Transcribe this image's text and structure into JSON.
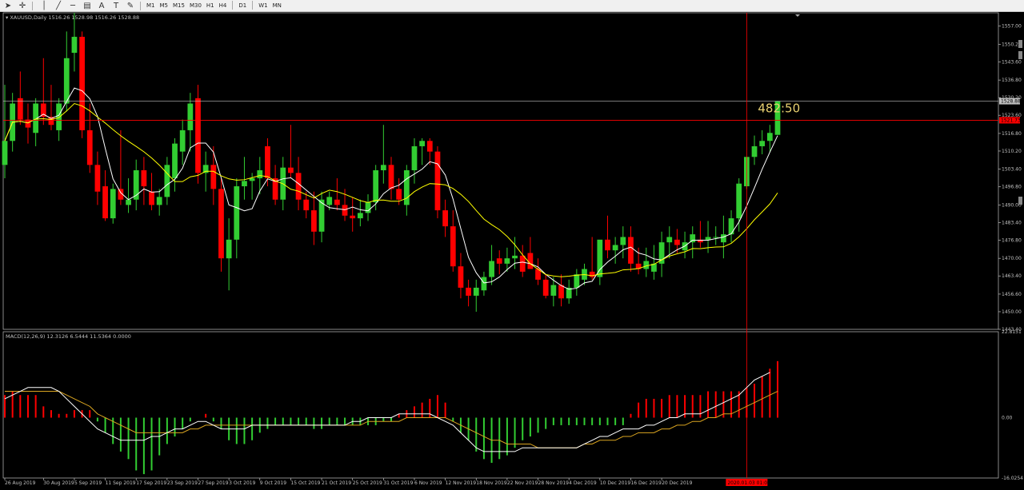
{
  "toolbar": {
    "tools": [
      "cursor-arrow-icon",
      "crosshair-icon",
      "vertical-line-icon",
      "trend-line-icon",
      "horizontal-line-icon",
      "channel-icon",
      "text-tool-icon",
      "label-tool-icon",
      "shapes-dropdown-icon"
    ],
    "timeframes": [
      "M1",
      "M5",
      "M15",
      "M30",
      "H1",
      "H4",
      "D1",
      "W1",
      "MN"
    ]
  },
  "colors": {
    "background": "#000000",
    "bull": "#32cd32",
    "bear": "#ff0000",
    "ma_fast": "#ffffff",
    "ma_slow": "#ffff00",
    "crosshair": "#ff0000",
    "grid_border": "#c0c0c0",
    "axis_text": "#c0c0c0",
    "bid_line": "#c0c0c0",
    "price_label": "#e8d070"
  },
  "chart_data": [
    {
      "type": "candlestick",
      "title": "XAUUSD,Daily",
      "ohlc_header": "1516.26 1528.98 1516.26 1528.88",
      "ylim": [
        1443.4,
        1562.0
      ],
      "y_ticks": [
        "1557.00",
        "1550.20",
        "1543.60",
        "1536.80",
        "1530.20",
        "1523.60",
        "1516.80",
        "1510.20",
        "1503.40",
        "1496.80",
        "1490.00",
        "1483.40",
        "1476.80",
        "1470.00",
        "1463.40",
        "1456.60",
        "1450.00",
        "1443.40"
      ],
      "x_ticks": [
        "26 Aug 2019",
        "30 Aug 2019",
        "5 Sep 2019",
        "11 Sep 2019",
        "17 Sep 2019",
        "23 Sep 2019",
        "27 Sep 2019",
        "3 Oct 2019",
        "9 Oct 2019",
        "15 Oct 2019",
        "21 Oct 2019",
        "25 Oct 2019",
        "31 Oct 2019",
        "6 Nov 2019",
        "12 Nov 2019",
        "18 Nov 2019",
        "22 Nov 2019",
        "28 Nov 2019",
        "4 Dec 2019",
        "10 Dec 2019",
        "16 Dec 2019",
        "20 Dec 2019"
      ],
      "current_price": "1528.88",
      "crosshair_price": "1521.73",
      "crosshair_readout": "482:50",
      "crosshair_date": "2020.01.03 01:00",
      "crosshair_index": 96,
      "moving_averages": [
        {
          "period": 5,
          "color": "#ffffff"
        },
        {
          "period": 13,
          "color": "#ffff00"
        }
      ],
      "candles": [
        [
          1505,
          1535,
          1500,
          1514
        ],
        [
          1514,
          1532,
          1510,
          1528
        ],
        [
          1530,
          1540,
          1520,
          1522
        ],
        [
          1522,
          1528,
          1513,
          1519
        ],
        [
          1517,
          1530,
          1512,
          1528
        ],
        [
          1528,
          1545,
          1520,
          1523
        ],
        [
          1523,
          1535,
          1518,
          1520
        ],
        [
          1518,
          1530,
          1514,
          1528
        ],
        [
          1528,
          1555,
          1525,
          1545
        ],
        [
          1547,
          1562,
          1540,
          1553
        ],
        [
          1553,
          1555,
          1515,
          1518
        ],
        [
          1518,
          1528,
          1502,
          1505
        ],
        [
          1505,
          1510,
          1490,
          1495
        ],
        [
          1497,
          1503,
          1484,
          1485
        ],
        [
          1485,
          1498,
          1483,
          1496
        ],
        [
          1496,
          1518,
          1490,
          1492
        ],
        [
          1490,
          1500,
          1487,
          1492
        ],
        [
          1492,
          1507,
          1488,
          1503
        ],
        [
          1503,
          1508,
          1490,
          1497
        ],
        [
          1495,
          1502,
          1488,
          1490
        ],
        [
          1490,
          1496,
          1486,
          1493
        ],
        [
          1493,
          1508,
          1490,
          1505
        ],
        [
          1500,
          1515,
          1495,
          1513
        ],
        [
          1510,
          1522,
          1505,
          1518
        ],
        [
          1518,
          1532,
          1510,
          1528
        ],
        [
          1530,
          1535,
          1498,
          1502
        ],
        [
          1502,
          1510,
          1495,
          1505
        ],
        [
          1505,
          1512,
          1490,
          1496
        ],
        [
          1496,
          1500,
          1465,
          1470
        ],
        [
          1470,
          1485,
          1458,
          1477
        ],
        [
          1477,
          1500,
          1470,
          1497
        ],
        [
          1497,
          1508,
          1492,
          1499
        ],
        [
          1499,
          1502,
          1492,
          1500
        ],
        [
          1500,
          1508,
          1494,
          1503
        ],
        [
          1512,
          1515,
          1497,
          1500
        ],
        [
          1500,
          1505,
          1490,
          1492
        ],
        [
          1492,
          1508,
          1488,
          1504
        ],
        [
          1504,
          1520,
          1500,
          1502
        ],
        [
          1502,
          1508,
          1488,
          1492
        ],
        [
          1492,
          1495,
          1485,
          1488
        ],
        [
          1488,
          1495,
          1475,
          1480
        ],
        [
          1480,
          1495,
          1476,
          1492
        ],
        [
          1490,
          1495,
          1488,
          1493
        ],
        [
          1492,
          1500,
          1488,
          1490
        ],
        [
          1490,
          1496,
          1484,
          1486
        ],
        [
          1486,
          1493,
          1480,
          1485
        ],
        [
          1485,
          1492,
          1482,
          1487
        ],
        [
          1487,
          1494,
          1484,
          1491
        ],
        [
          1491,
          1505,
          1488,
          1503
        ],
        [
          1503,
          1520,
          1498,
          1505
        ],
        [
          1505,
          1508,
          1492,
          1496
        ],
        [
          1496,
          1500,
          1490,
          1492
        ],
        [
          1490,
          1505,
          1486,
          1503
        ],
        [
          1503,
          1515,
          1498,
          1512
        ],
        [
          1512,
          1515,
          1505,
          1514
        ],
        [
          1514,
          1515,
          1505,
          1510
        ],
        [
          1510,
          1512,
          1485,
          1488
        ],
        [
          1488,
          1492,
          1478,
          1482
        ],
        [
          1482,
          1488,
          1465,
          1467
        ],
        [
          1467,
          1472,
          1455,
          1459
        ],
        [
          1459,
          1462,
          1452,
          1456
        ],
        [
          1456,
          1462,
          1450,
          1459
        ],
        [
          1458,
          1465,
          1456,
          1463
        ],
        [
          1463,
          1475,
          1460,
          1469
        ],
        [
          1470,
          1473,
          1464,
          1468
        ],
        [
          1468,
          1474,
          1465,
          1470
        ],
        [
          1470,
          1478,
          1466,
          1471
        ],
        [
          1471,
          1475,
          1463,
          1465
        ],
        [
          1472,
          1478,
          1468,
          1466
        ],
        [
          1466,
          1470,
          1460,
          1462
        ],
        [
          1462,
          1464,
          1455,
          1456
        ],
        [
          1456,
          1463,
          1452,
          1460
        ],
        [
          1460,
          1464,
          1452,
          1455
        ],
        [
          1455,
          1462,
          1453,
          1459
        ],
        [
          1459,
          1466,
          1456,
          1464
        ],
        [
          1462,
          1468,
          1460,
          1466
        ],
        [
          1465,
          1478,
          1462,
          1463
        ],
        [
          1463,
          1476,
          1460,
          1477
        ],
        [
          1477,
          1486,
          1470,
          1473
        ],
        [
          1473,
          1478,
          1468,
          1475
        ],
        [
          1475,
          1482,
          1470,
          1478
        ],
        [
          1478,
          1482,
          1465,
          1468
        ],
        [
          1468,
          1474,
          1464,
          1466
        ],
        [
          1466,
          1474,
          1463,
          1469
        ],
        [
          1465,
          1475,
          1462,
          1468
        ],
        [
          1468,
          1480,
          1463,
          1476
        ],
        [
          1476,
          1482,
          1470,
          1478
        ],
        [
          1477,
          1481,
          1472,
          1475
        ],
        [
          1473,
          1480,
          1470,
          1476
        ],
        [
          1476,
          1482,
          1470,
          1479
        ],
        [
          1477,
          1484,
          1474,
          1476
        ],
        [
          1477,
          1484,
          1472,
          1478
        ],
        [
          1478,
          1482,
          1475,
          1478
        ],
        [
          1476,
          1486,
          1470,
          1479
        ],
        [
          1479,
          1488,
          1476,
          1485
        ],
        [
          1485,
          1500,
          1480,
          1498
        ],
        [
          1497,
          1508,
          1496,
          1508
        ],
        [
          1508,
          1516,
          1505,
          1512
        ],
        [
          1512,
          1518,
          1509,
          1514
        ],
        [
          1514,
          1520,
          1510,
          1517
        ],
        [
          1516.26,
          1528.98,
          1516.26,
          1528.88
        ]
      ]
    },
    {
      "type": "histogram",
      "title": "MACD(12,26,9) 12.3126 6.5444 11.5364 0.0000",
      "ylim": [
        -16.0254,
        22.8151
      ],
      "y_ticks": [
        "22.8151",
        "0.00",
        "-16.0254"
      ],
      "histogram": [
        6,
        7,
        6,
        6,
        6,
        3,
        2,
        1,
        1,
        2,
        2,
        2,
        -1,
        -4,
        -7,
        -9,
        -11,
        -14,
        -15,
        -14,
        -10,
        -7,
        -5,
        -3,
        -1,
        0,
        1,
        -1,
        -3,
        -6,
        -7,
        -7,
        -6,
        -4,
        -3,
        -2,
        -2,
        -2,
        -2,
        -2,
        -3,
        -3,
        -2,
        -2,
        -2,
        -2,
        -2,
        -2,
        -2,
        -1,
        -1,
        1,
        2,
        3,
        4,
        5,
        6,
        4,
        -1,
        -4,
        -6,
        -9,
        -11,
        -12,
        -11,
        -10,
        -8,
        -6,
        -5,
        -4,
        -3,
        -2,
        -2,
        -2,
        -2,
        -2,
        -2,
        -2,
        -2,
        -2,
        -2,
        1,
        4,
        5,
        5,
        5,
        6,
        6,
        6,
        6,
        6,
        7,
        7,
        7,
        7,
        7,
        8,
        9,
        11,
        13,
        15
      ],
      "macd_line": [
        5,
        6,
        7,
        8,
        8,
        8,
        8,
        7,
        5,
        3,
        1,
        -1,
        -3,
        -4,
        -5,
        -6,
        -6,
        -6,
        -6,
        -5,
        -5,
        -4,
        -3,
        -3,
        -2,
        -1,
        -1,
        -2,
        -3,
        -3,
        -3,
        -3,
        -2,
        -2,
        -2,
        -2,
        -2,
        -2,
        -2,
        -2,
        -2,
        -2,
        -2,
        -2,
        -2,
        -1,
        -1,
        0,
        0,
        0,
        0,
        1,
        1,
        1,
        1,
        1,
        0,
        -1,
        -2,
        -4,
        -6,
        -8,
        -9,
        -9,
        -9,
        -9,
        -9,
        -8,
        -8,
        -8,
        -8,
        -8,
        -8,
        -8,
        -8,
        -7,
        -6,
        -5,
        -5,
        -4,
        -3,
        -3,
        -3,
        -2,
        -2,
        -1,
        0,
        0,
        1,
        1,
        1,
        2,
        3,
        4,
        5,
        6,
        8,
        10,
        11,
        12
      ],
      "signal_line": [
        7,
        7,
        7,
        7,
        7,
        7,
        7,
        7,
        6,
        5,
        4,
        3,
        1,
        0,
        -1,
        -2,
        -3,
        -4,
        -4,
        -4,
        -4,
        -4,
        -4,
        -4,
        -3,
        -3,
        -2,
        -2,
        -2,
        -2,
        -2,
        -2,
        -2,
        -2,
        -2,
        -2,
        -2,
        -2,
        -2,
        -2,
        -2,
        -2,
        -2,
        -2,
        -2,
        -2,
        -2,
        -1,
        -1,
        -1,
        -1,
        -1,
        0,
        0,
        0,
        0,
        0,
        0,
        -1,
        -2,
        -3,
        -4,
        -5,
        -6,
        -6,
        -7,
        -7,
        -7,
        -7,
        -8,
        -8,
        -8,
        -8,
        -8,
        -8,
        -7,
        -7,
        -6,
        -6,
        -6,
        -5,
        -5,
        -4,
        -4,
        -4,
        -3,
        -3,
        -2,
        -2,
        -1,
        -1,
        0,
        0,
        1,
        1,
        2,
        3,
        4,
        5,
        6,
        7
      ]
    }
  ]
}
